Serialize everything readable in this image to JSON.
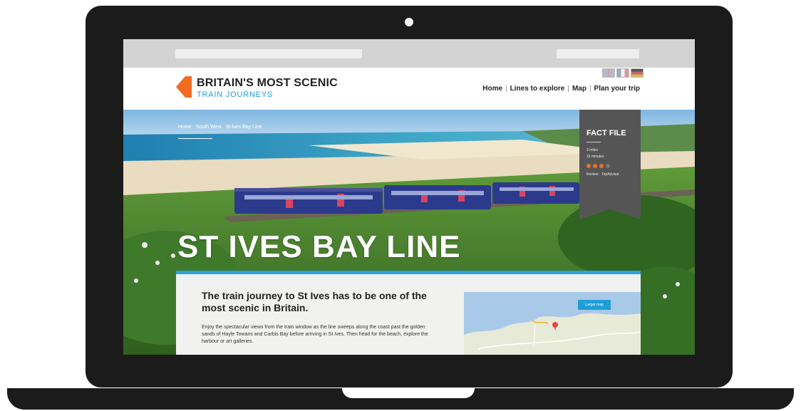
{
  "site": {
    "logo_line1": "BRITAIN'S MOST SCENIC",
    "logo_line2": "TRAIN JOURNEYS"
  },
  "nav": {
    "items": [
      "Home",
      "Lines to explore",
      "Map",
      "Plan your trip"
    ],
    "separator": "|"
  },
  "breadcrumb": [
    "Home",
    "South West",
    "St Ives Bay Line"
  ],
  "fact_file": {
    "title": "FACT FILE",
    "distance": "3 miles",
    "duration": "15 minutes",
    "rating_filled": 3,
    "rating_total": 4,
    "review": "Review · TripAdvisor"
  },
  "hero": {
    "title": "ST IVES BAY LINE"
  },
  "intro": {
    "heading": "The train journey to St Ives has to be one of the most scenic in Britain.",
    "body": "Enjoy the spectacular views from the train window as the line sweeps along the coast past the golden sands of Hayle Towans and Carbis Bay before arriving in St Ives. Then head for the beach, explore the harbour or art galleries."
  },
  "map": {
    "button": "Larger map"
  },
  "colors": {
    "accent_blue": "#1f9ed8",
    "logo_orange": "#f26b21",
    "fact_file_bg": "#555555",
    "star": "#e8722a"
  }
}
